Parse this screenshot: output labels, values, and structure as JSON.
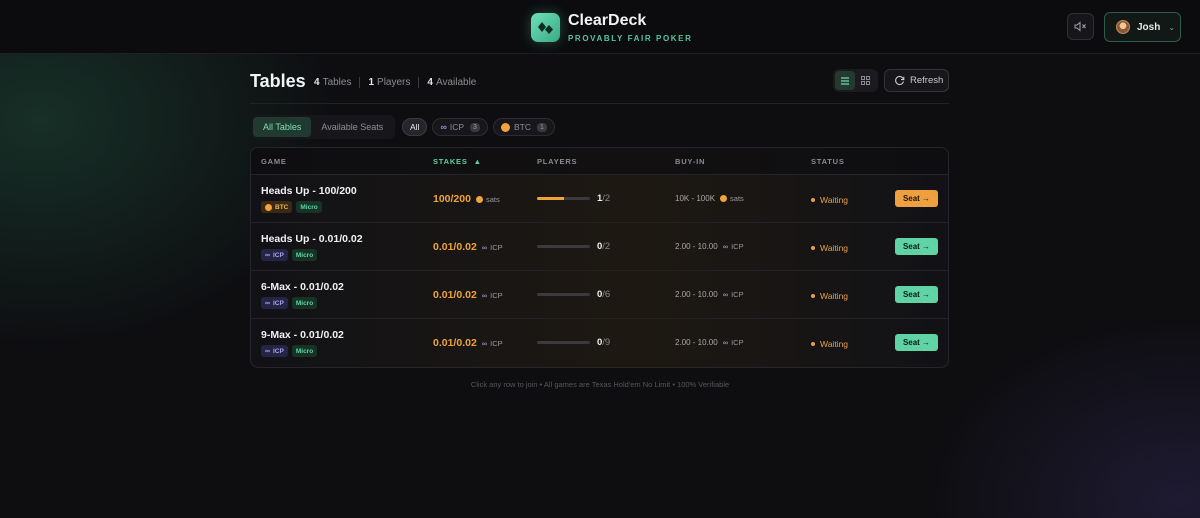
{
  "brand": {
    "name": "ClearDeck",
    "tagline": "PROVABLY FAIR POKER"
  },
  "user": {
    "name": "Josh"
  },
  "icons": {
    "mute": "speaker-mute-icon",
    "chevron": "chevron-down-icon",
    "list": "list-view-icon",
    "grid": "grid-view-icon",
    "refresh": "refresh-icon"
  },
  "header": {
    "title": "Tables",
    "stats": [
      {
        "value": "4",
        "label": "Tables"
      },
      {
        "value": "1",
        "label": "Players"
      },
      {
        "value": "4",
        "label": "Available"
      }
    ],
    "refresh_label": "Refresh"
  },
  "filters": {
    "segments": [
      "All Tables",
      "Available Seats"
    ],
    "chips": [
      {
        "label": "All"
      },
      {
        "label": "ICP",
        "count": "3"
      },
      {
        "label": "BTC",
        "count": "1"
      }
    ]
  },
  "table": {
    "columns": [
      "GAME",
      "STAKES",
      "PLAYERS",
      "BUY-IN",
      "STATUS"
    ],
    "sort_indicator": "▲",
    "rows": [
      {
        "name": "Heads Up - 100/200",
        "currency": "BTC",
        "level": "Micro",
        "stakes": "100/200",
        "unit": "sats",
        "players": "1",
        "max": "/2",
        "fill": 0.5,
        "buyin": "10K - 100K",
        "buyin_unit": "sats",
        "status": "Waiting",
        "action": "Seat →"
      },
      {
        "name": "Heads Up - 0.01/0.02",
        "currency": "ICP",
        "level": "Micro",
        "stakes": "0.01/0.02",
        "unit": "ICP",
        "players": "0",
        "max": "/2",
        "fill": 0,
        "buyin": "2.00 - 10.00",
        "buyin_unit": "ICP",
        "status": "Waiting",
        "action": "Seat →"
      },
      {
        "name": "6-Max - 0.01/0.02",
        "currency": "ICP",
        "level": "Micro",
        "stakes": "0.01/0.02",
        "unit": "ICP",
        "players": "0",
        "max": "/6",
        "fill": 0,
        "buyin": "2.00 - 10.00",
        "buyin_unit": "ICP",
        "status": "Waiting",
        "action": "Seat →"
      },
      {
        "name": "9-Max - 0.01/0.02",
        "currency": "ICP",
        "level": "Micro",
        "stakes": "0.01/0.02",
        "unit": "ICP",
        "players": "0",
        "max": "/9",
        "fill": 0,
        "buyin": "2.00 - 10.00",
        "buyin_unit": "ICP",
        "status": "Waiting",
        "action": "Seat →"
      }
    ]
  },
  "footer_note": "Click any row to join • All games are Texas Hold'em No Limit • 100% Verifiable",
  "colors": {
    "accent": "#5fd2a6",
    "btc": "#f0a33c",
    "icp": "#a6a6ea"
  }
}
